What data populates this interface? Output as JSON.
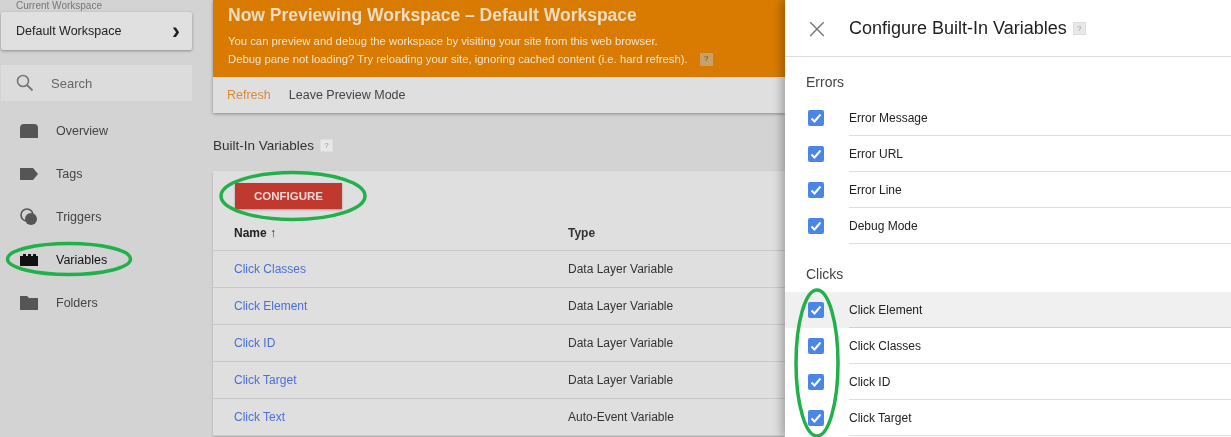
{
  "sidebar": {
    "workspace_label": "Current Workspace",
    "workspace": "Default Workspace",
    "workspace_arrow": "›",
    "search": {
      "placeholder": "Search"
    },
    "items": [
      {
        "label": "Overview",
        "kind": "overview",
        "selected": false
      },
      {
        "label": "Tags",
        "kind": "tag",
        "selected": false
      },
      {
        "label": "Triggers",
        "kind": "trigger",
        "selected": false
      },
      {
        "label": "Variables",
        "kind": "variable",
        "selected": true
      },
      {
        "label": "Folders",
        "kind": "folder",
        "selected": false
      }
    ]
  },
  "preview_banner": {
    "title": "Now Previewing Workspace – Default Workspace",
    "lines": [
      "You can preview and debug the workspace by visiting your site from this web browser.",
      "Debug pane not loading? Try reloading your site, ignoring cached content (i.e. hard refresh)."
    ],
    "help": "?",
    "actions": [
      {
        "label": "Refresh",
        "kind": "primary"
      },
      {
        "label": "Leave Preview Mode",
        "kind": "plain"
      }
    ]
  },
  "builtin_variables": {
    "title": "Built-In Variables",
    "help": "?",
    "configure_button": "CONFIGURE",
    "columns": [
      "Name ↑",
      "Type"
    ],
    "rows": [
      {
        "name": "Click Classes",
        "type": "Data Layer Variable"
      },
      {
        "name": "Click Element",
        "type": "Data Layer Variable"
      },
      {
        "name": "Click ID",
        "type": "Data Layer Variable"
      },
      {
        "name": "Click Target",
        "type": "Data Layer Variable"
      },
      {
        "name": "Click Text",
        "type": "Auto-Event Variable"
      }
    ]
  },
  "config_panel": {
    "close": "×",
    "title": "Configure Built-In Variables",
    "help": "?",
    "groups": [
      {
        "title": "Errors",
        "items": [
          {
            "label": "Error Message",
            "checked": true,
            "hovered": false
          },
          {
            "label": "Error URL",
            "checked": true,
            "hovered": false
          },
          {
            "label": "Error Line",
            "checked": true,
            "hovered": false
          },
          {
            "label": "Debug Mode",
            "checked": true,
            "hovered": false
          }
        ]
      },
      {
        "title": "Clicks",
        "items": [
          {
            "label": "Click Element",
            "checked": true,
            "hovered": true
          },
          {
            "label": "Click Classes",
            "checked": true,
            "hovered": false
          },
          {
            "label": "Click ID",
            "checked": true,
            "hovered": false
          },
          {
            "label": "Click Target",
            "checked": true,
            "hovered": false
          }
        ]
      }
    ]
  }
}
